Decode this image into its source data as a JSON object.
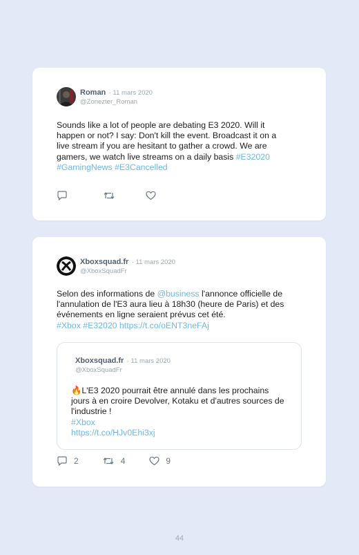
{
  "tweets": [
    {
      "name": "Roman",
      "date": "· 11 mars 2020",
      "handle": "@Zonezter_Roman",
      "text_lines": [
        "Sounds like a lot of people are debating E3 2020. Will it",
        "happen or not? I say: Don't kill the event. Broadcast it on a",
        "live stream if you are hesitant to gather a crowd. We are",
        "gamers, we watch live streams on a daily basis "
      ],
      "hashtag_inline": "#E32020",
      "hashtags_line": "#GamingNews #E3Cancelled"
    },
    {
      "name": "Xboxsquad.fr",
      "date": "· 11 mars 2020",
      "handle": "@XboxSquadFr",
      "text_a": "Selon des informations de ",
      "mention": "@business",
      "text_b": " l'annonce officielle de l'annulation de l'E3 aura lieu à 18h30 (heure de Paris) et des événements en ligne seraient prévus cet été.",
      "links_line": "#Xbox #E32020 https://t.co/oENT3neFAj",
      "quote": {
        "name": "Xboxsquad.fr",
        "date": "· 11 mars 2020",
        "handle": "@XboxSquadFr",
        "emoji": "🔥",
        "text": "L'E3 2020 pourrait être annulé dans les prochains jours à en croire Devolver, Kotaku et d'autres sources de l'industrie !",
        "hashtag": "#Xbox",
        "url": "https://t.co/HJv0Ehi3xj"
      },
      "reply_count": "2",
      "retweet_count": "4",
      "like_count": "9"
    }
  ],
  "page_number": "44",
  "colors": {
    "background": "#e4e9f8",
    "card": "#ffffff",
    "link": "#6cb8e6",
    "muted": "#9aa6b2",
    "name": "#4f5f6f"
  },
  "icons": [
    "reply-icon",
    "retweet-icon",
    "like-icon",
    "xbox-logo-avatar",
    "user-avatar"
  ]
}
